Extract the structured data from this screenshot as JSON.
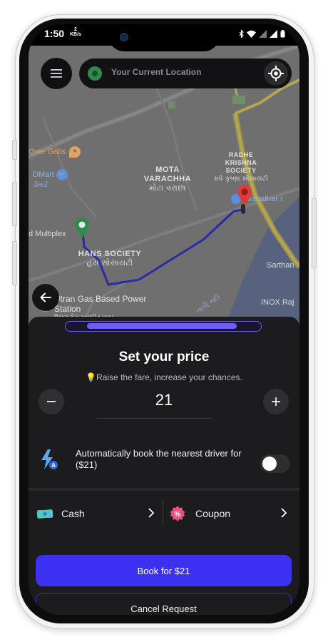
{
  "status_bar": {
    "time": "1:50",
    "speed_value": "2",
    "speed_unit": "KB/s"
  },
  "map": {
    "search": {
      "placeholder": "Your Current Location"
    },
    "areas": [
      {
        "name": "MOTA VARACHHA",
        "native": "મોટા વરાછા"
      },
      {
        "name": "RADHE KRISHNA SOCIETY",
        "native": "રાધે કૃષ્ણા સોસાયટી"
      },
      {
        "name": "HANS SOCIETY",
        "native": "હંસ સોસાયટી"
      }
    ],
    "pois": {
      "over_grills": "Over Grills",
      "dmart": "DMart",
      "dmart_native": "ડીમાર્ટ",
      "multiplex": "d Multiplex",
      "utran_gas": "Utran Gas Based Power Station",
      "utran_gas_native": "ઉત્રાણ ગેસ આધારિત પાવર સ્ટેશન",
      "satadhar": "t satadhar r",
      "sarthana": "Sarthan",
      "inox": "INOX Raj",
      "river": "તાપી નદી"
    }
  },
  "sheet": {
    "progress_fraction": 0.87,
    "title": "Set your price",
    "subtitle": "💡Raise the fare, increase your chances.",
    "price": "21",
    "auto_book_label": "Automatically book the nearest driver for ($21)",
    "auto_book_enabled": false,
    "payment_label": "Cash",
    "coupon_label": "Coupon",
    "book_button": "Book for $21",
    "cancel_button": "Cancel Request"
  },
  "colors": {
    "accent": "#3c31f0",
    "progress": "#6d5cf5",
    "route": "#2b2aa8",
    "pickup_pin": "#2f8a4c",
    "drop_pin": "#e03a3a"
  }
}
